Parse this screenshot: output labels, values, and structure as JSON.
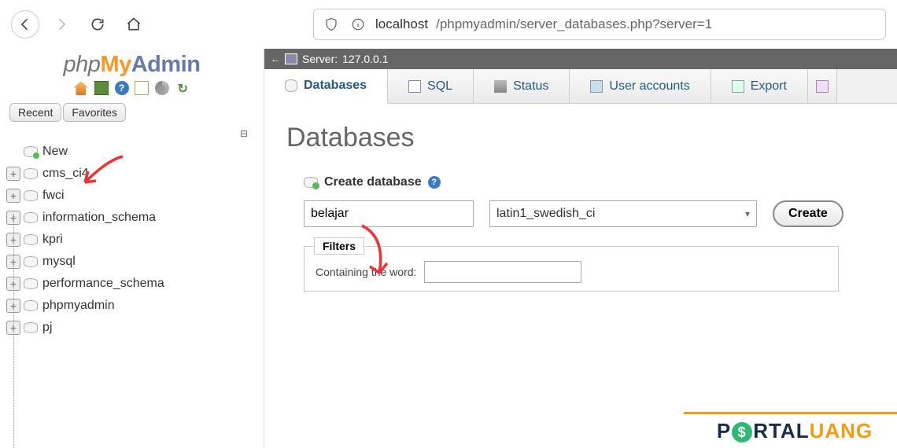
{
  "browser": {
    "url_host": "localhost",
    "url_path": "/phpmyadmin/server_databases.php?server=1"
  },
  "sidebar": {
    "logo": {
      "php": "php",
      "my": "My",
      "admin": "Admin"
    },
    "recent": "Recent",
    "favorites": "Favorites",
    "new_label": "New",
    "databases": [
      "cms_ci4",
      "fwci",
      "information_schema",
      "kpri",
      "mysql",
      "performance_schema",
      "phpmyadmin",
      "pj"
    ]
  },
  "breadcrumb": {
    "server_label": "Server:",
    "server_value": "127.0.0.1"
  },
  "tabs": {
    "databases": "Databases",
    "sql": "SQL",
    "status": "Status",
    "user_accounts": "User accounts",
    "export": "Export"
  },
  "main": {
    "title": "Databases",
    "create_label": "Create database",
    "dbname_value": "belajar",
    "collation_value": "latin1_swedish_ci",
    "create_button": "Create",
    "filters_legend": "Filters",
    "containing_label": "Containing the word:",
    "containing_value": ""
  },
  "watermark": {
    "p1": "P",
    "dollar": "$",
    "p2": "RTAL",
    "p3": "UANG"
  }
}
